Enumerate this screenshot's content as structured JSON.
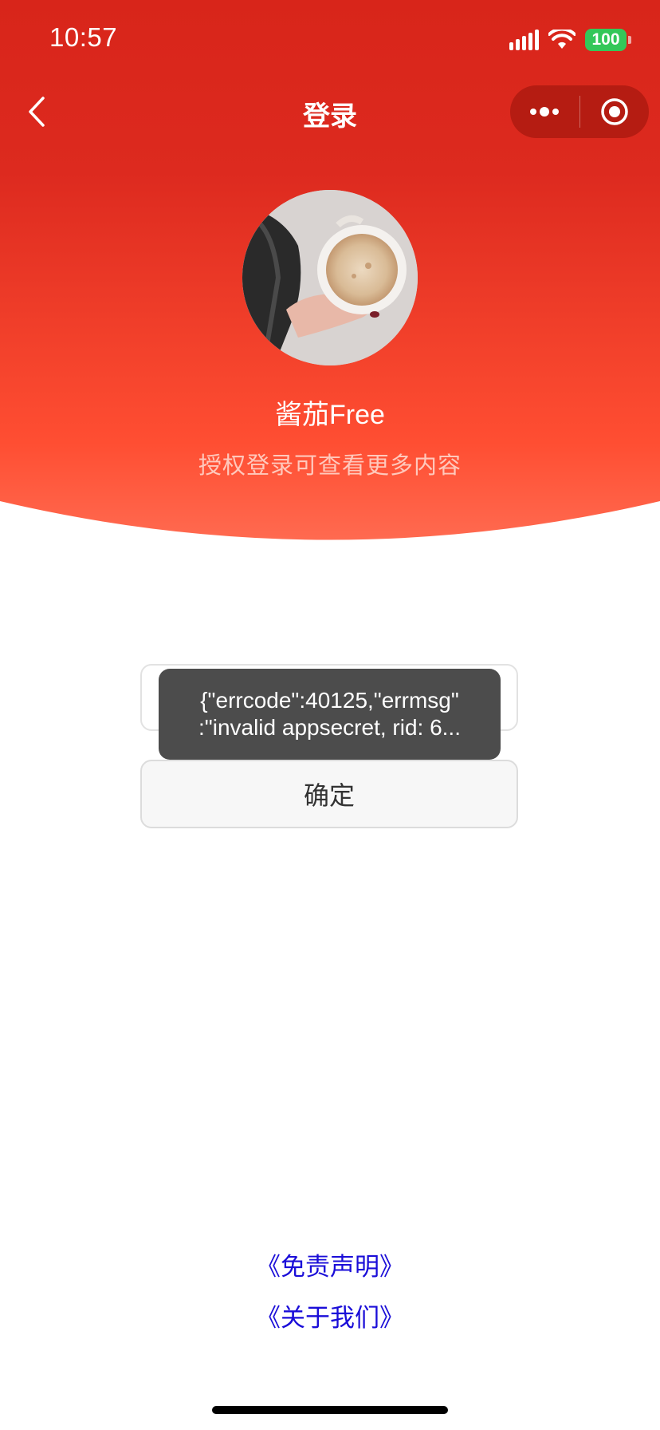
{
  "status_bar": {
    "time": "10:57",
    "battery": "100"
  },
  "nav": {
    "title": "登录"
  },
  "profile": {
    "name": "酱茄Free",
    "subtitle": "授权登录可查看更多内容"
  },
  "form": {
    "confirm_label": "确定"
  },
  "toast": {
    "line1": "{\"errcode\":40125,\"errmsg\"",
    "line2": ":\"invalid appsecret, rid: 6..."
  },
  "links": {
    "disclaimer": "《免责声明》",
    "about": "《关于我们》"
  },
  "icons": {
    "back": "chevron-left-icon",
    "more": "more-dots-icon",
    "close": "target-circle-icon",
    "signal": "cellular-signal-icon",
    "wifi": "wifi-icon",
    "battery": "battery-icon"
  },
  "colors": {
    "header_top": "#d8251a",
    "header_bottom": "#ff5a3c",
    "toast_bg": "#4c4c4c",
    "link": "#1a0dd8"
  }
}
